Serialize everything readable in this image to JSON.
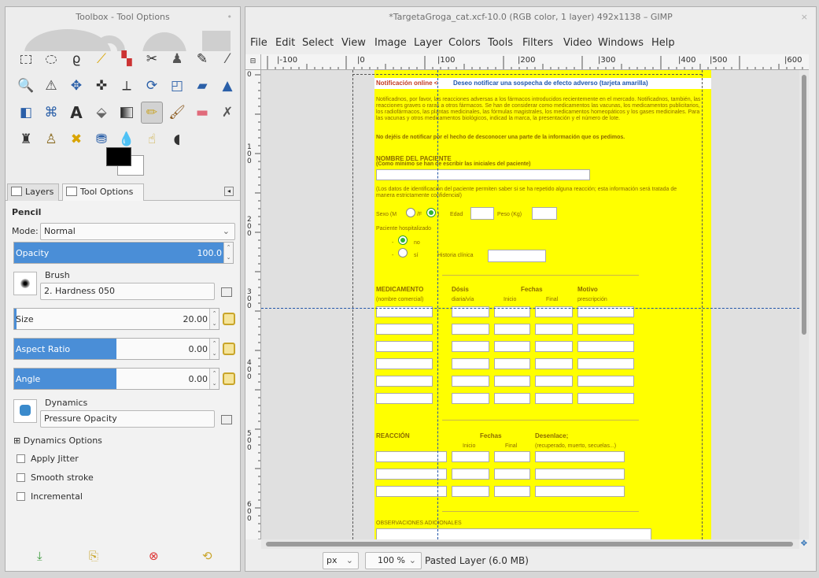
{
  "toolbox": {
    "title": "Toolbox - Tool Options",
    "tabs": {
      "layers": "Layers",
      "tool_options": "Tool Options"
    },
    "tool_name": "Pencil",
    "mode_label": "Mode:",
    "mode_value": "Normal",
    "opacity": {
      "label": "Opacity",
      "value": "100.0",
      "fraction": 1.0
    },
    "brush": {
      "label": "Brush",
      "value": "2. Hardness 050"
    },
    "size": {
      "label": "Size",
      "value": "20.00",
      "fraction": 0.01
    },
    "aspect_ratio": {
      "label": "Aspect Ratio",
      "value": "0.00",
      "fraction": 0.5
    },
    "angle": {
      "label": "Angle",
      "value": "0.00",
      "fraction": 0.5
    },
    "dynamics": {
      "label": "Dynamics",
      "value": "Pressure Opacity"
    },
    "dynamics_options": "Dynamics Options",
    "checks": [
      "Apply Jitter",
      "Smooth stroke",
      "Incremental"
    ],
    "colors": {
      "fg": "#000000",
      "bg": "#ffffff",
      "accent": "#4a8ed7"
    }
  },
  "gimp": {
    "title": "*TargetaGroga_cat.xcf-10.0 (RGB color, 1 layer) 492x1138 – GIMP",
    "menu": [
      "File",
      "Edit",
      "Select",
      "View",
      "Image",
      "Layer",
      "Colors",
      "Tools",
      "Filters",
      "Video",
      "Windows",
      "Help"
    ],
    "ruler_h": [
      "|-100",
      "|0",
      "|100",
      "|200",
      "|300",
      "|400",
      "|500",
      "|600"
    ],
    "ruler_v": [
      "0",
      "1\n0\n0",
      "2\n0\n0",
      "3\n0\n0",
      "4\n0\n0",
      "5\n0\n0",
      "6\n0\n0"
    ],
    "status": {
      "unit": "px",
      "zoom": "100 %",
      "layer": "Pasted Layer (6.0 MB)"
    }
  },
  "doc": {
    "header_prefix": "Notificación online <",
    "header_link": "Deseo notificar una sospecha de efecto adverso (tarjeta amarilla)",
    "intro": "Notificadnos, por favor, las reacciones adversas a los fármacos introducidos recientemente en el mercado. Notificadnos, también, las reacciones graves o raras a otros fármacos. Se han de considerar como medicamentos las vacunas, los medicamentos publicitarios, los radiofármacos, las plantas medicinales, las fórmulas magistrales, los medicamentos homeopáticos y los gases medicinales. Para las vacunas y otros medicamentos biológicos, indicad la marca, la presentación y el número de lote.",
    "intro_bold": "No dejéis de notificar por el hecho de desconocer una parte de la información que os pedimos.",
    "patient_title": "NOMBRE DEL PACIENTE",
    "patient_sub": "(Como mínimo se han de escribir las iniciales del paciente)",
    "patient_note": "(Los datos de identificación del paciente permiten saber si se ha repetido alguna reacción; esta información será tratada de manera estrictamente confidencial)",
    "sexo": "Sexo (M",
    "sexo_f": "/F",
    "sexo_end": ")",
    "edad": "Edad",
    "peso": "Peso (Kg)",
    "hospital": "Paciente hospitalizado",
    "no": "no",
    "si": "sí",
    "historia": "Historia clínica",
    "med_cols": [
      "MEDICAMENTO",
      "Dósis",
      "Fechas",
      "Motivo"
    ],
    "med_sub": [
      "(nombre comercial)",
      "diaria/vía",
      "Inicio",
      "Final",
      "prescripción"
    ],
    "reac_cols": [
      "REACCIÓN",
      "Fechas",
      "Desenlace;"
    ],
    "reac_sub": [
      "Inicio",
      "Final",
      "(recuperado, muerto, secuelas...)"
    ],
    "obs": "OBSERVACIONES ADICIONALES"
  }
}
